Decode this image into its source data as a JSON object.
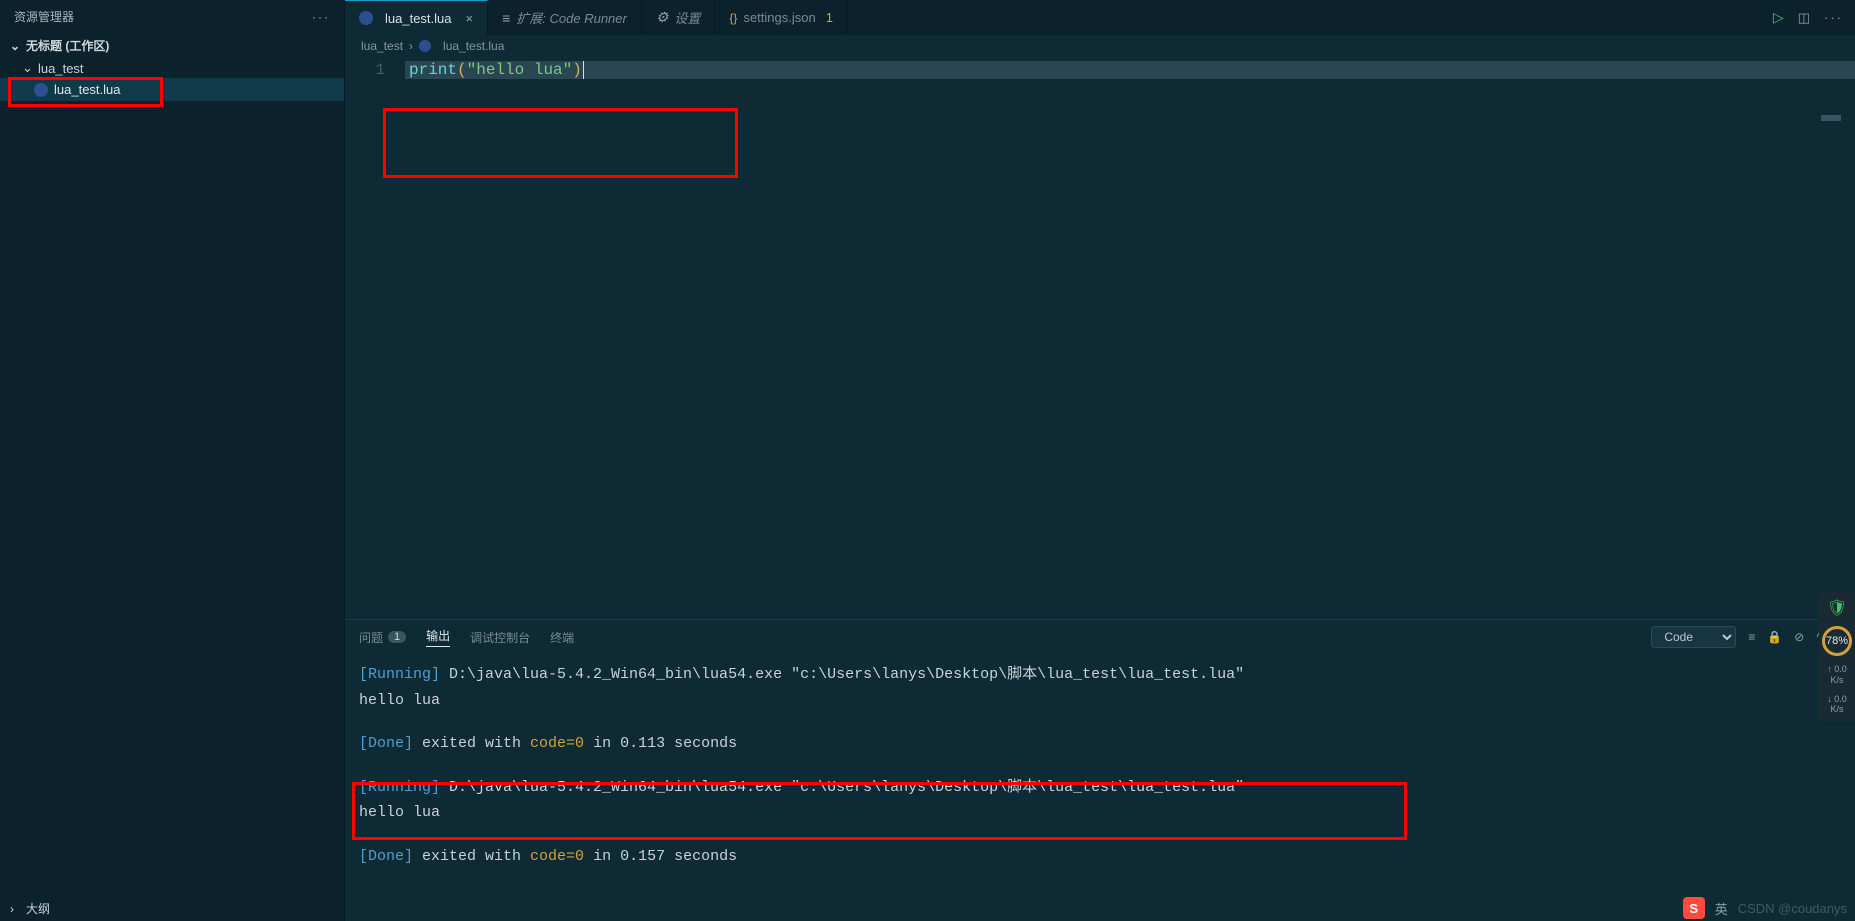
{
  "sidebar": {
    "title": "资源管理器",
    "workspace": "无标题 (工作区)",
    "folder": "lua_test",
    "file": "lua_test.lua",
    "outline": "大纲"
  },
  "tabs": [
    {
      "label": "lua_test.lua",
      "icon": "lua",
      "active": true,
      "closable": true
    },
    {
      "label": "扩展: Code Runner",
      "icon": "ext",
      "active": false,
      "italic": true
    },
    {
      "label": "设置",
      "icon": "gear",
      "active": false,
      "italic": true
    },
    {
      "label": "settings.json",
      "icon": "json",
      "active": false,
      "badge": "1"
    }
  ],
  "breadcrumb": {
    "folder": "lua_test",
    "file": "lua_test.lua"
  },
  "editor": {
    "line_number": "1",
    "tok_print": "print",
    "tok_lparen": "(",
    "tok_str": "\"hello lua\"",
    "tok_rparen": ")"
  },
  "panel": {
    "tabs": {
      "problems": "问题",
      "problems_count": "1",
      "output": "输出",
      "debug": "调试控制台",
      "terminal": "终端"
    },
    "filter": "Code",
    "output": {
      "run1_label": "[Running]",
      "run1_cmd": " D:\\java\\lua-5.4.2_Win64_bin\\lua54.exe \"c:\\Users\\lanys\\Desktop\\脚本\\lua_test\\lua_test.lua\"",
      "run1_out": "hello lua",
      "done1_label": "[Done]",
      "done1_a": " exited with ",
      "done1_code": "code=0",
      "done1_b": " in 0.113 seconds",
      "run2_label": "[Running]",
      "run2_cmd": " D:\\java\\lua-5.4.2_Win64_bin\\lua54.exe \"c:\\Users\\lanys\\Desktop\\脚本\\lua_test\\lua_test.lua\"",
      "run2_out": "hello lua",
      "done2_label": "[Done]",
      "done2_a": " exited with ",
      "done2_code": "code=0",
      "done2_b": " in 0.157 seconds"
    }
  },
  "widget": {
    "percent": "78%",
    "up": "0.0",
    "up_u": "K/s",
    "dn": "0.0",
    "dn_u": "K/s"
  },
  "ime": {
    "lang": "英",
    "watermark": "CSDN @coudanys"
  }
}
